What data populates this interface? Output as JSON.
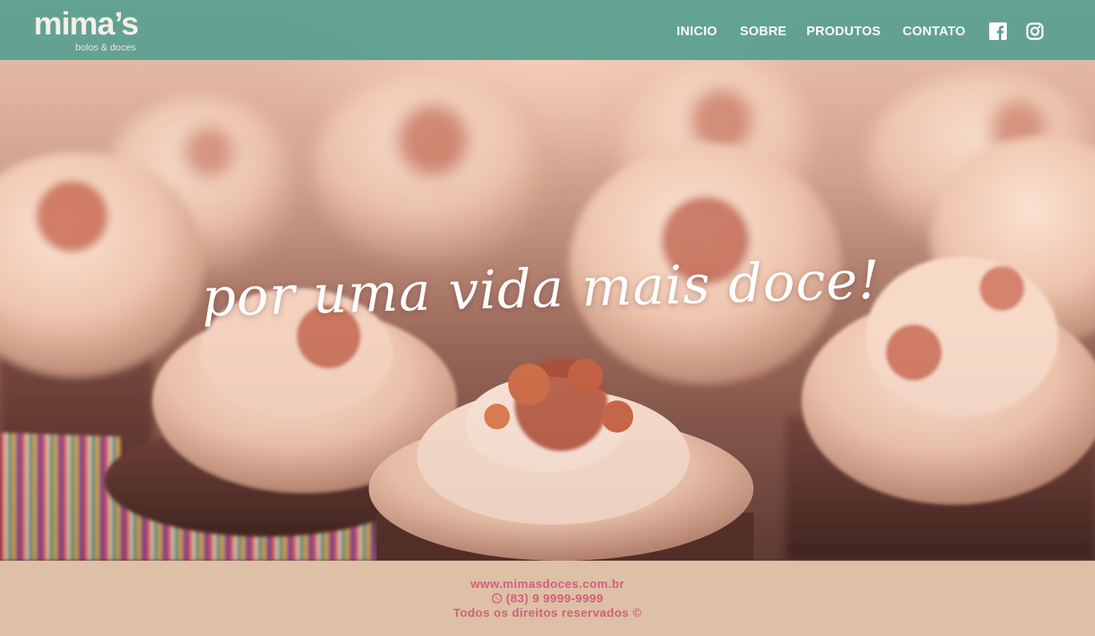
{
  "brand": {
    "name": "mima’s",
    "tagline_small": "bolos & doces"
  },
  "nav": {
    "items": [
      {
        "label": "INICIO"
      },
      {
        "label": "SOBRE"
      },
      {
        "label": "PRODUTOS"
      },
      {
        "label": "CONTATO"
      }
    ],
    "social": [
      {
        "icon": "facebook-icon"
      },
      {
        "icon": "instagram-icon"
      }
    ]
  },
  "hero": {
    "headline": "por uma vida mais doce!",
    "background": "cupcakes-photo"
  },
  "footer": {
    "website": "www.mimasdoces.com.br",
    "phone": "(83) 9 9999-9999",
    "phone_icon": "whatsapp-icon",
    "copyright": "Todos os direitos reservados ©"
  },
  "colors": {
    "header_bg": "#58a091",
    "footer_bg": "#ddc0a6",
    "footer_text": "#d2607a",
    "nav_text": "#ffffff"
  }
}
